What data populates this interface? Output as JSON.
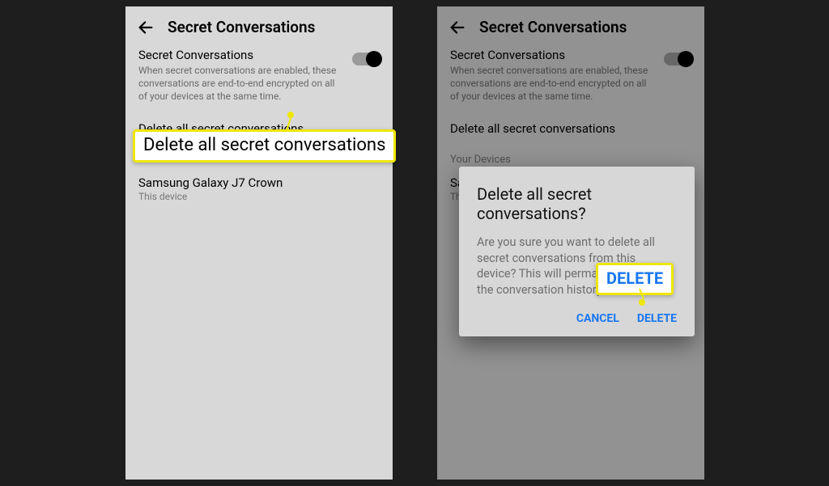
{
  "appbar": {
    "title": "Secret Conversations"
  },
  "toggle_row": {
    "title": "Secret Conversations",
    "subtitle": "When secret conversations are enabled, these conversations are end-to-end encrypted on all of your devices at the same time."
  },
  "delete_row": {
    "label": "Delete all secret conversations"
  },
  "devices_section": {
    "label": "Your Devices",
    "device_name": "Samsung Galaxy J7 Crown",
    "device_sub": "This device"
  },
  "callout": {
    "delete_big": "Delete all secret conversations",
    "delete_btn": "DELETE"
  },
  "dialog": {
    "title": "Delete all secret conversations?",
    "body": "Are you sure you want to delete all secret conversations from this device? This will permanently delete the conversation history.",
    "cancel": "CANCEL",
    "confirm": "DELETE"
  }
}
